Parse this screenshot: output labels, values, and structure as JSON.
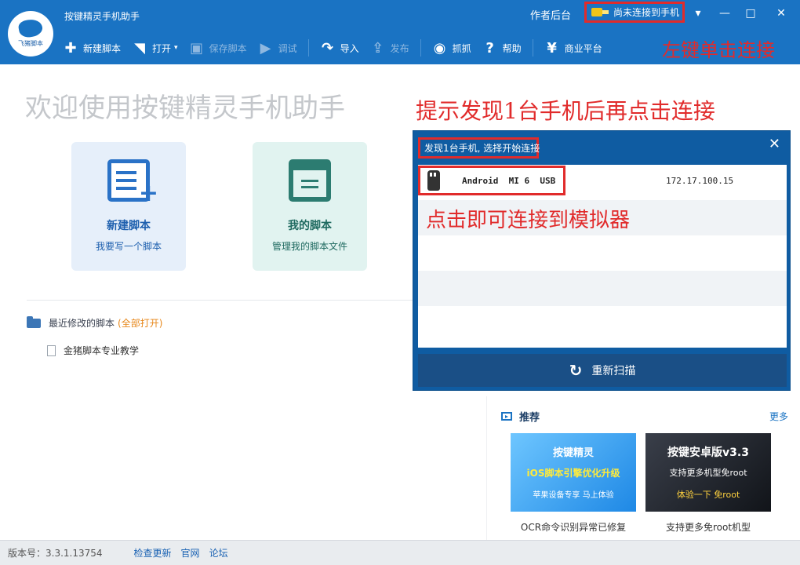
{
  "app": {
    "title": "按键精灵手机助手",
    "logo_text": "飞猪脚本"
  },
  "header": {
    "author_link": "作者后台",
    "connect_status": "尚未连接到手机"
  },
  "toolbar": {
    "new": "新建脚本",
    "open": "打开",
    "save": "保存脚本",
    "debug": "调试",
    "import": "导入",
    "publish": "发布",
    "capture": "抓抓",
    "help": "帮助",
    "business": "商业平台"
  },
  "annotations": {
    "top": "左键单击连接",
    "mid": "提示发现1台手机后再点击连接",
    "device": "点击即可连接到模拟器"
  },
  "welcome": "欢迎使用按键精灵手机助手",
  "cards": [
    {
      "title": "新建脚本",
      "subtitle": "我要写一个脚本"
    },
    {
      "title": "我的脚本",
      "subtitle": "管理我的脚本文件"
    }
  ],
  "recent": {
    "label": "最近修改的脚本",
    "open_all": "(全部打开)",
    "items": [
      "金猪脚本专业教学"
    ]
  },
  "dialog": {
    "title": "发现1台手机, 选择开始连接",
    "device_name": "Android  MI 6  USB",
    "device_ip": "172.17.100.15",
    "rescan": "重新扫描"
  },
  "recommend": {
    "title": "推荐",
    "more": "更多",
    "banners": [
      {
        "top": "按键精灵",
        "mid": "iOS脚本引擎优化升级",
        "bot": "苹果设备专享 马上体验",
        "caption": "OCR命令识别异常已修复"
      },
      {
        "top": "按键安卓版v3.3",
        "mid": "支持更多机型免root",
        "bot": "体验一下 免root",
        "caption": "支持更多免root机型"
      }
    ]
  },
  "status": {
    "version": "版本号：3.3.1.13754",
    "check_update": "检查更新",
    "website": "官网",
    "forum": "论坛"
  },
  "colors": {
    "header": "#1a73c3",
    "annotation": "#e12b2b",
    "dialog": "#0f5ca2",
    "link": "#1a62b3"
  }
}
